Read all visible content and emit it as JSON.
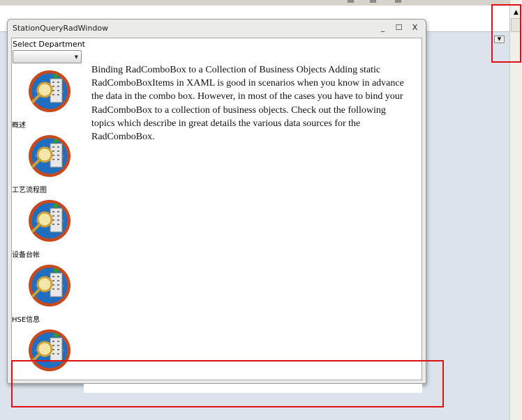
{
  "window": {
    "title": "StationQueryRadWindow",
    "controls": {
      "minimize": "_",
      "maximize": "☐",
      "close": "X"
    }
  },
  "department": {
    "label": "Select Department",
    "selected": ""
  },
  "nav_items": [
    {
      "label": "概述",
      "icon": "building-search-icon"
    },
    {
      "label": "工艺流程图",
      "icon": "building-search-icon"
    },
    {
      "label": "设备台帐",
      "icon": "building-search-icon"
    },
    {
      "label": "HSE信息",
      "icon": "building-search-icon"
    },
    {
      "label": "",
      "icon": "building-search-icon"
    }
  ],
  "description": "Binding RadComboBox to a Collection of Business Objects Adding static RadComboBoxItems in XAML is good in scenarios when you know in advance the data in the combo box. However, in most of the cases you have to bind your RadComboBox to a collection of business objects. Check out the following topics which describe in great details the various data sources for the RadComboBox.",
  "colors": {
    "annotation_red": "#e01010",
    "page_bg": "#dde3ec",
    "icon_blue": "#1f6ec0",
    "icon_ring": "#c64a1e"
  }
}
